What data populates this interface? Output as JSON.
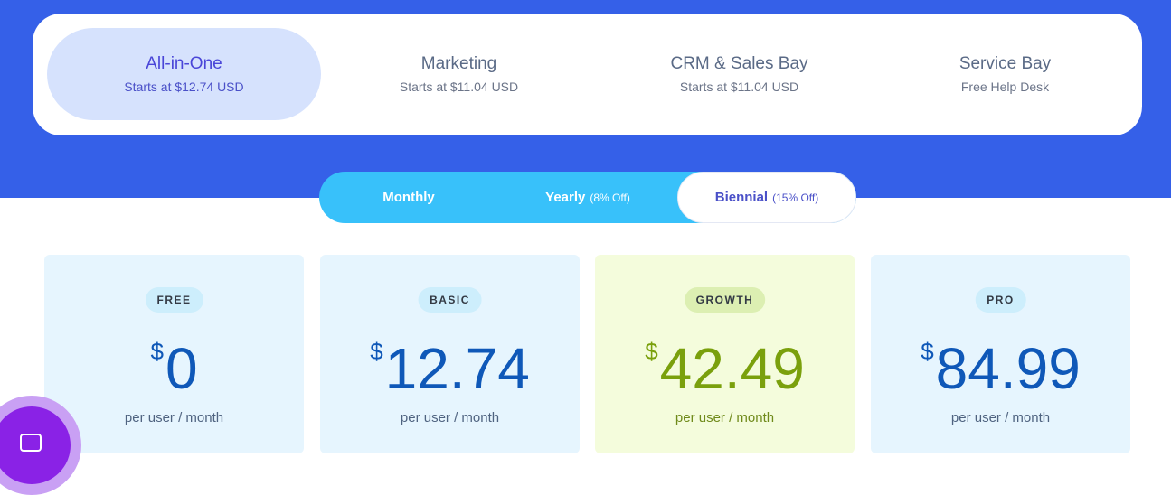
{
  "product_tabs": [
    {
      "name": "All-in-One",
      "sub": "Starts at $12.74 USD",
      "active": true
    },
    {
      "name": "Marketing",
      "sub": "Starts at $11.04 USD",
      "active": false
    },
    {
      "name": "CRM & Sales Bay",
      "sub": "Starts at $11.04 USD",
      "active": false
    },
    {
      "name": "Service Bay",
      "sub": "Free Help Desk",
      "active": false
    }
  ],
  "billing": {
    "monthly": {
      "label": "Monthly",
      "discount": ""
    },
    "yearly": {
      "label": "Yearly",
      "discount": "(8% Off)"
    },
    "biennial": {
      "label": "Biennial",
      "discount": "(15% Off)"
    },
    "selected": "biennial"
  },
  "plans": [
    {
      "badge": "FREE",
      "currency": "$",
      "price": "0",
      "period": "per user / month"
    },
    {
      "badge": "BASIC",
      "currency": "$",
      "price": "12.74",
      "period": "per user / month"
    },
    {
      "badge": "GROWTH",
      "currency": "$",
      "price": "42.49",
      "period": "per user / month"
    },
    {
      "badge": "PRO",
      "currency": "$",
      "price": "84.99",
      "period": "per user / month"
    }
  ],
  "chat_widget": {
    "icon": "chat-icon"
  },
  "colors": {
    "hero": "#3560e8",
    "toggle": "#38c1fa",
    "active_tab": "#d6e2fd",
    "price_blue": "#0f58b8",
    "price_green": "#7aa00c",
    "card_blue": "#e6f5fe",
    "card_green": "#f4fcdc"
  }
}
